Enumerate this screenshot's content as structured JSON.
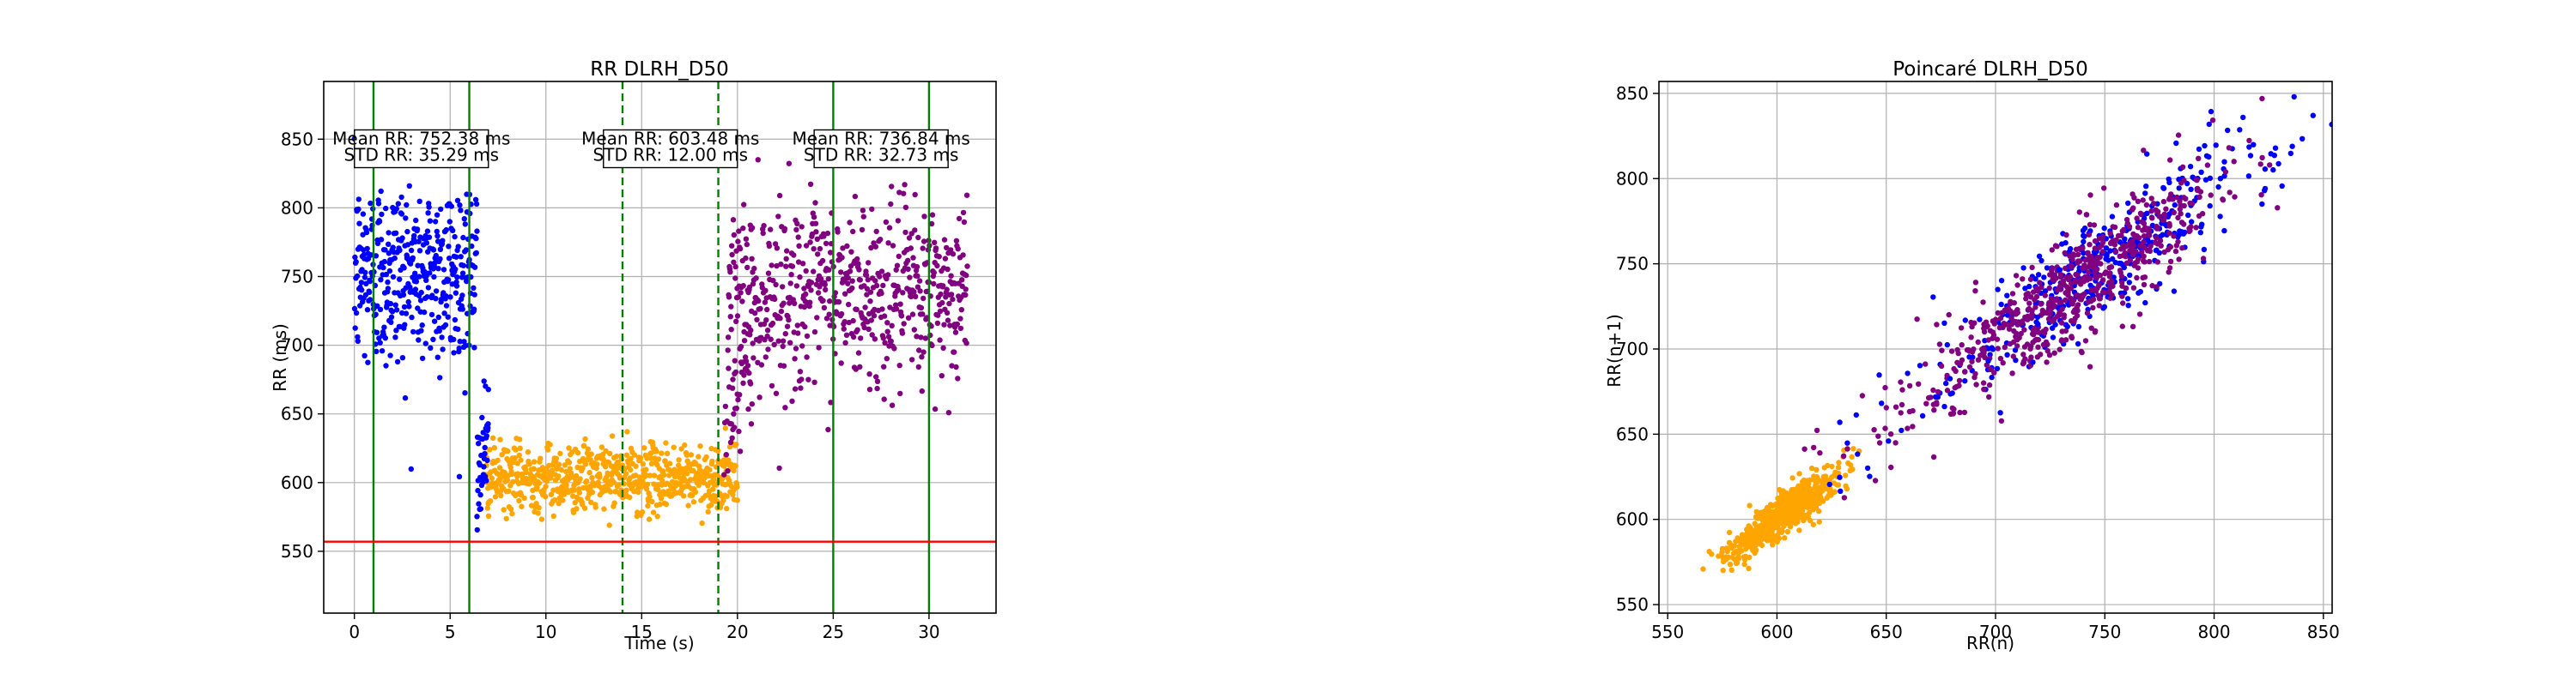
{
  "chart_data": [
    {
      "type": "scatter",
      "title": "RR DLRH_D50",
      "xlabel": "Time (s)",
      "ylabel": "RR (ms)",
      "xlim": [
        -1.6,
        33.5
      ],
      "ylim": [
        505,
        892
      ],
      "xticks": [
        0,
        5,
        10,
        15,
        20,
        25,
        30
      ],
      "yticks": [
        550,
        600,
        650,
        700,
        750,
        800,
        850
      ],
      "grid": true,
      "reference_lines": [
        {
          "orientation": "vertical",
          "x": 1,
          "style": "solid",
          "color": "#008000"
        },
        {
          "orientation": "vertical",
          "x": 6,
          "style": "solid",
          "color": "#008000"
        },
        {
          "orientation": "vertical",
          "x": 14,
          "style": "dashed",
          "color": "#008000"
        },
        {
          "orientation": "vertical",
          "x": 19,
          "style": "dashed",
          "color": "#008000"
        },
        {
          "orientation": "vertical",
          "x": 25,
          "style": "solid",
          "color": "#008000"
        },
        {
          "orientation": "vertical",
          "x": 30,
          "style": "solid",
          "color": "#008000"
        },
        {
          "orientation": "horizontal",
          "y": 557,
          "style": "solid",
          "color": "#ff0000"
        }
      ],
      "annotations": [
        {
          "x": 3.5,
          "y": 843,
          "lines": [
            "Mean RR: 752.38 ms",
            "STD RR: 35.29 ms"
          ]
        },
        {
          "x": 16.5,
          "y": 843,
          "lines": [
            "Mean RR: 603.48 ms",
            "STD RR: 12.00 ms"
          ]
        },
        {
          "x": 27.5,
          "y": 843,
          "lines": [
            "Mean RR: 736.84 ms",
            "STD RR: 32.73 ms"
          ]
        }
      ],
      "series": [
        {
          "color": "#0000ff",
          "x_range": [
            0,
            6.4
          ],
          "mean": 752.38,
          "std": 35.29,
          "points": 420
        },
        {
          "color": "#ffa500",
          "x_range": [
            6.8,
            20.0
          ],
          "mean": 603.48,
          "std": 12.0,
          "points": 700
        },
        {
          "color": "#800080",
          "x_range": [
            19.5,
            32.0
          ],
          "mean": 736.84,
          "std": 32.73,
          "points": 620
        }
      ],
      "transitions": [
        {
          "color": "#0000ff",
          "x_range": [
            6.4,
            7.0
          ],
          "y_range": [
            560,
            690
          ]
        },
        {
          "color": "#800080",
          "x_range": [
            19.3,
            20.8
          ],
          "y_range": [
            595,
            720
          ]
        }
      ]
    },
    {
      "type": "scatter",
      "title": "Poincaré DLRH_D50",
      "xlabel": "RR(n)",
      "ylabel": "RR(n+1)",
      "xlim": [
        546,
        854
      ],
      "ylim": [
        545,
        857
      ],
      "xticks": [
        550,
        600,
        650,
        700,
        750,
        800,
        850
      ],
      "yticks": [
        550,
        600,
        650,
        700,
        750,
        800,
        850
      ],
      "grid": true,
      "series": [
        {
          "color": "#ffa500",
          "center": [
            603.48,
            603.48
          ],
          "std": 12.0,
          "points": 700
        },
        {
          "color": "#0000ff",
          "center": [
            752.38,
            752.38
          ],
          "std": 35.29,
          "points": 400
        },
        {
          "color": "#800080",
          "center": [
            736.84,
            736.84
          ],
          "std": 32.73,
          "points": 600
        }
      ]
    }
  ]
}
